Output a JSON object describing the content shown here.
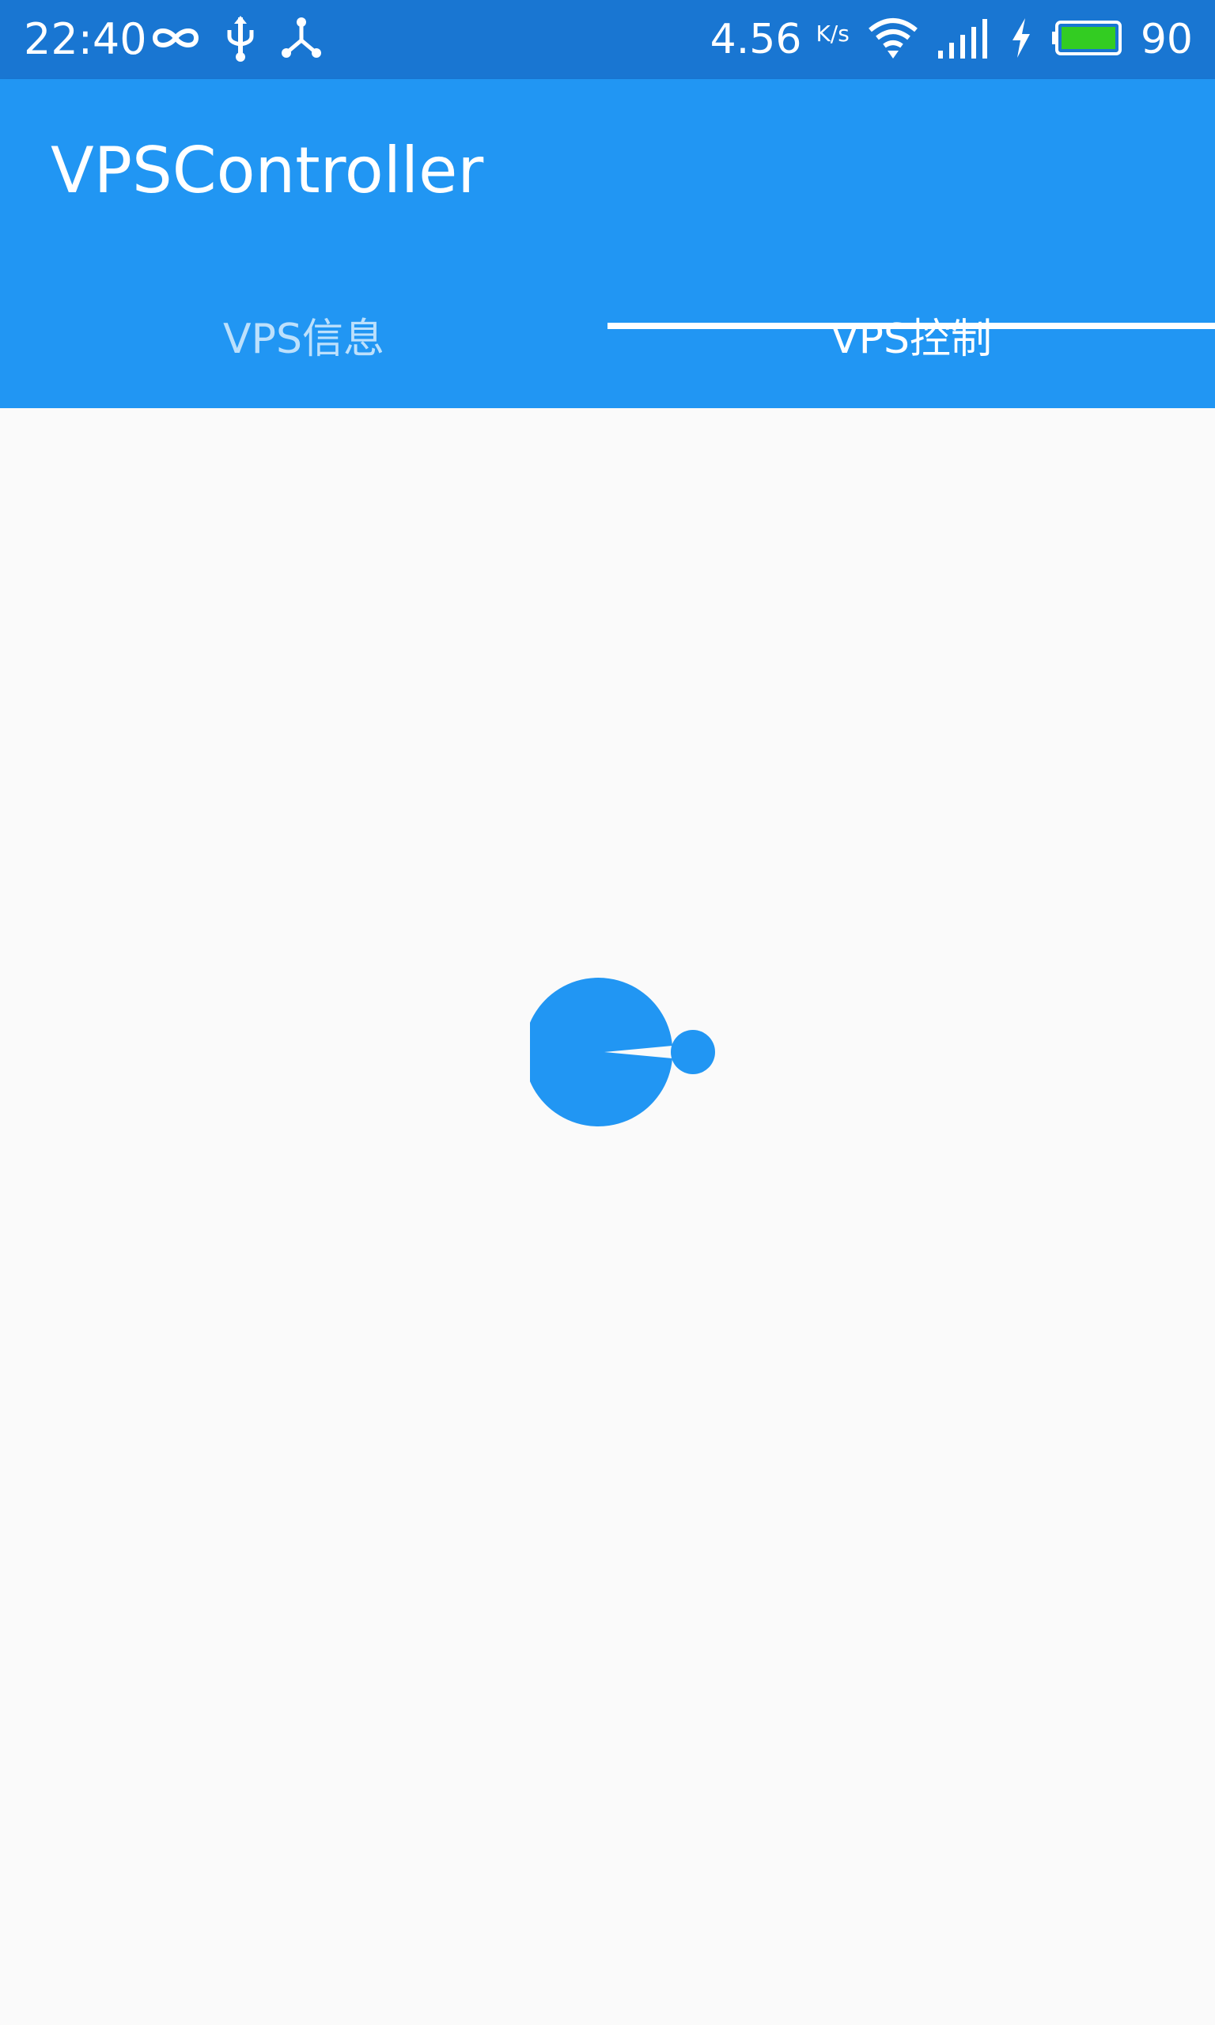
{
  "status_bar": {
    "time": "22:40",
    "left_icons": [
      "infinity-icon",
      "usb-icon",
      "hotspot-icon"
    ],
    "network_speed": "4.56",
    "network_speed_unit": "K/s",
    "battery_level": "90",
    "right_icons": [
      "wifi-icon",
      "signal-icon",
      "charging-icon",
      "battery-icon"
    ]
  },
  "app_bar": {
    "title": "VPSController"
  },
  "tabs": [
    {
      "label": "VPS信息",
      "active": false
    },
    {
      "label": "VPS控制",
      "active": true
    }
  ],
  "content": {
    "loading_indicator": "loading-spinner-icon"
  },
  "colors": {
    "status_bar": "#1976d2",
    "primary": "#2196f3",
    "background": "#fafafa",
    "battery_fill": "#33cc22"
  }
}
